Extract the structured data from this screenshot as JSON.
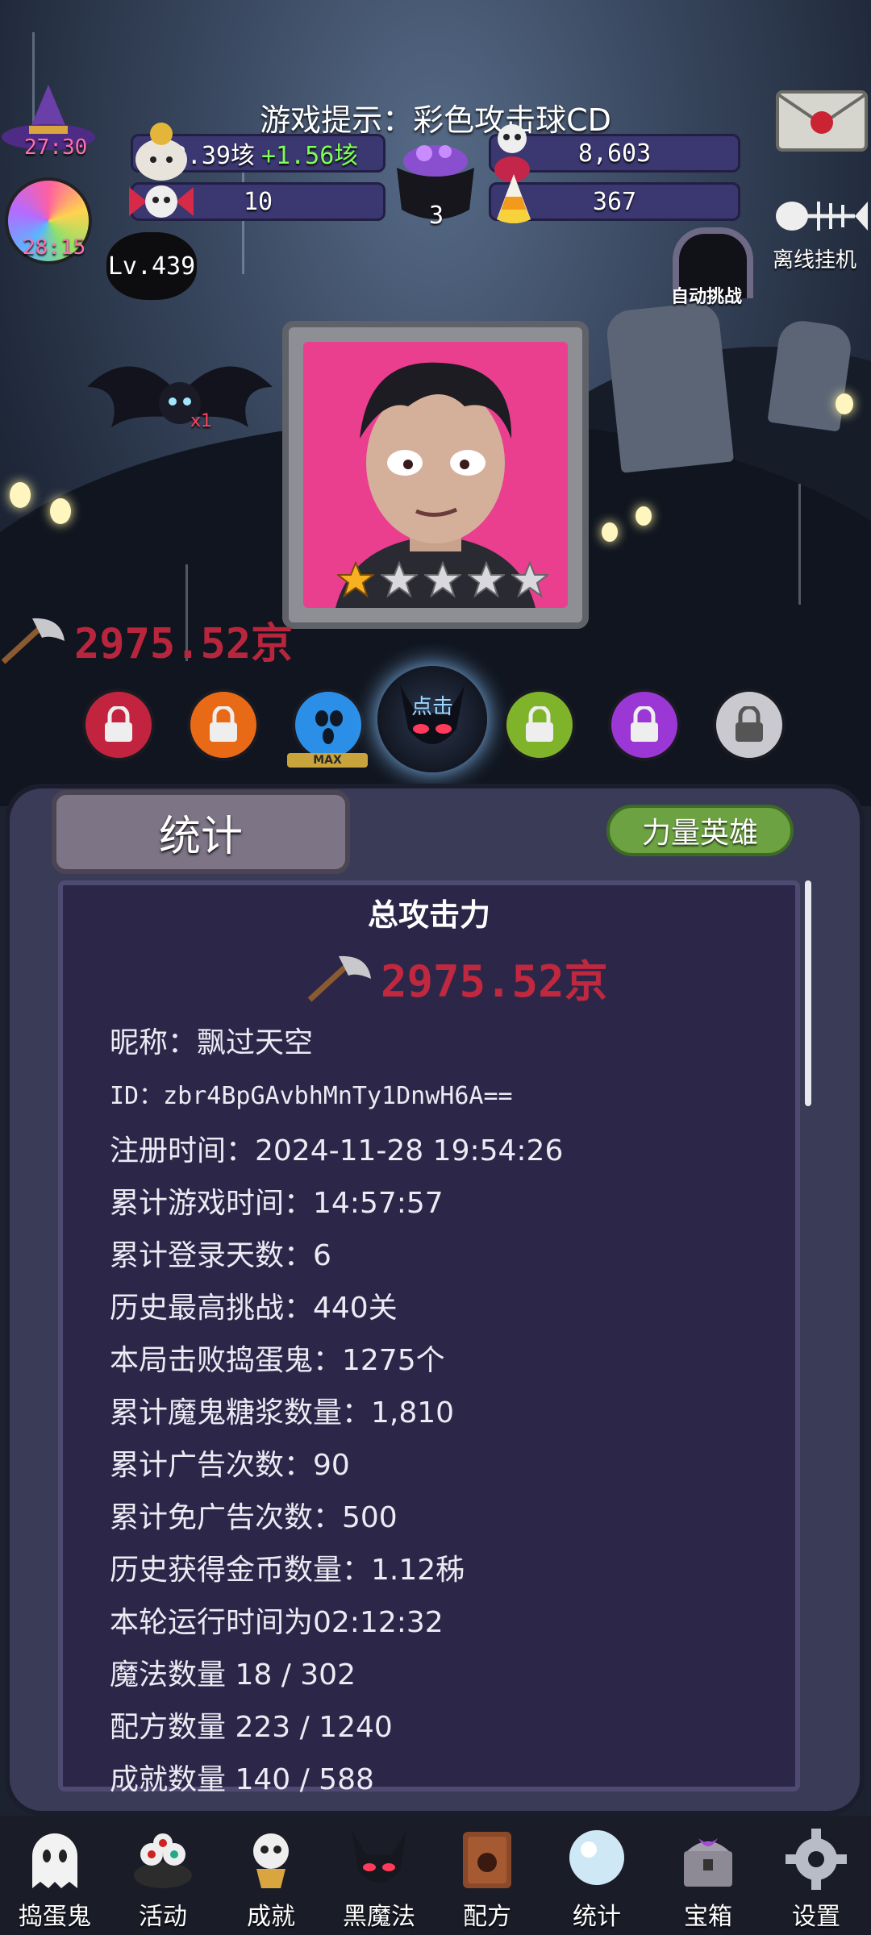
{
  "hint": "游戏提示：彩色攻击球CD",
  "timers": {
    "hat_timer": "27:30",
    "candy_timer": "28:15"
  },
  "resources": {
    "gold_value": "32.39垓",
    "gold_gain": "+1.56垓",
    "skulls": "8,603",
    "tickets": "10",
    "cauldron": "3",
    "candy_corn": "367"
  },
  "level": "Lv.439",
  "auto_challenge": "自动挑战",
  "offline": "离线挂机",
  "bat_multiplier": "x1",
  "attack_top": "2975.52京",
  "hero_stars": {
    "filled": 1,
    "total": 5
  },
  "skills": {
    "max_label": "MAX",
    "dark_label": "点击"
  },
  "panel": {
    "tab_stats": "统计",
    "tab_hero": "力量英雄",
    "title": "总攻击力",
    "attack": "2975.52京",
    "lines": [
      "昵称：飘过天空",
      "ID：zbr4BpGAvbhMnTy1DnwH6A==",
      "注册时间：2024-11-28 19:54:26",
      "累计游戏时间：14:57:57",
      "累计登录天数：6",
      "历史最高挑战：440关",
      "本局击败捣蛋鬼：1275个",
      "累计魔鬼糖浆数量：1,810",
      "累计广告次数：90",
      "累计免广告次数：500",
      "历史获得金币数量：1.12秭",
      "本轮运行时间为02:12:32",
      "魔法数量 18 / 302",
      "配方数量 223 / 1240",
      "成就数量 140 / 588"
    ]
  },
  "nav": [
    {
      "label": "捣蛋鬼",
      "icon": "ghost-icon"
    },
    {
      "label": "活动",
      "icon": "eyeballs-icon"
    },
    {
      "label": "成就",
      "icon": "skull-trophy-icon"
    },
    {
      "label": "黑魔法",
      "icon": "demon-icon"
    },
    {
      "label": "配方",
      "icon": "recipe-book-icon"
    },
    {
      "label": "统计",
      "icon": "crystal-ball-icon"
    },
    {
      "label": "宝箱",
      "icon": "chest-icon"
    },
    {
      "label": "设置",
      "icon": "gear-icon"
    }
  ],
  "colors": {
    "accent_red": "#c0283f",
    "green_gain": "#7dff56",
    "panel_bg": "#2c2748",
    "portrait_bg": "#ea3e8f"
  }
}
